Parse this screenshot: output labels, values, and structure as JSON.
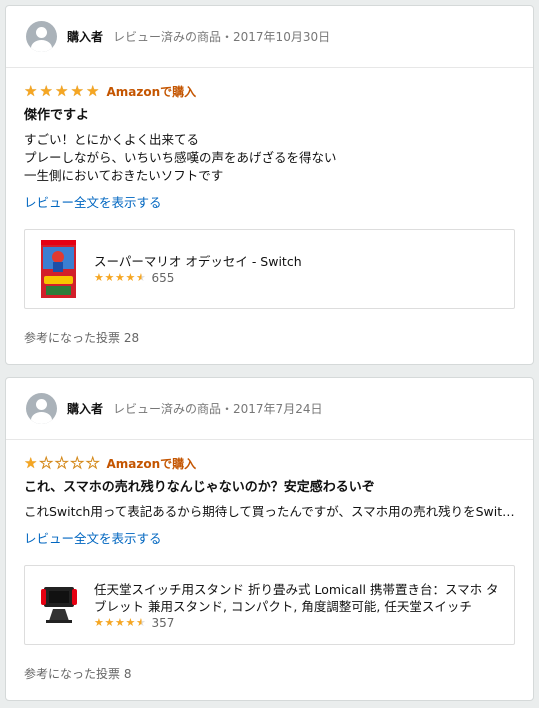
{
  "reviews": [
    {
      "reviewer": "購入者",
      "meta": "レビュー済みの商品・2017年10月30日",
      "stars": 5,
      "badge": "Amazonで購入",
      "title": "傑作ですよ",
      "text": "すごい！とにかくよく出来てる\nプレーしながら、いちいち感嘆の声をあげざるを得ない\n一生側においておきたいソフトです",
      "full_link": "レビュー全文を表示する",
      "product": {
        "name": "スーパーマリオ オデッセイ - Switch",
        "rating": 4.5,
        "rating_count": "655"
      },
      "helpful": "参考になった投票 28"
    },
    {
      "reviewer": "購入者",
      "meta": "レビュー済みの商品・2017年7月24日",
      "stars": 1,
      "badge": "Amazonで購入",
      "title": "これ、スマホの売れ残りなんじゃないのか？安定感わるいぞ",
      "text": "これSwitch用って表記あるから期待して買ったんですが、スマホ用の売れ残りをSwitch用として売ってるだけ",
      "full_link": "レビュー全文を表示する",
      "product": {
        "name": "任天堂スイッチ用スタンド 折り畳み式 Lomicall 携帯置き台：スマホ タブレット 兼用スタンド, コンパクト, 角度調整可能, 任天堂スイッチ",
        "rating": 4.5,
        "rating_count": "357"
      },
      "helpful": "参考になった投票 8"
    }
  ],
  "colors": {
    "star": "#f5a623",
    "badge": "#c45500",
    "link": "#0066c0",
    "background": "#eaeded"
  },
  "icons": {
    "avatar": "user-avatar-icon",
    "star_full": "star-full-icon",
    "star_empty": "star-empty-icon",
    "star_half": "star-half-icon"
  }
}
